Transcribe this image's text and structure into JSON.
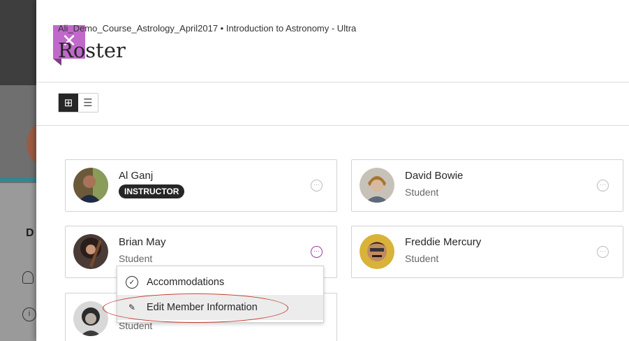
{
  "breadcrumb": "Ali_Demo_Course_Astrology_April2017 • Introduction to Astronomy - Ultra",
  "title": "Roster",
  "close_icon": "✕",
  "background": {
    "letter": "D",
    "info_glyph": "i"
  },
  "view_toggle": {
    "grid_icon": "⊞",
    "list_icon": "☰"
  },
  "more_glyph": "···",
  "members": [
    {
      "name": "Al Ganj",
      "role": "INSTRUCTOR",
      "is_instructor": true
    },
    {
      "name": "David Bowie",
      "role": "Student"
    },
    {
      "name": "Brian May",
      "role": "Student"
    },
    {
      "name": "Freddie Mercury",
      "role": "Student"
    },
    {
      "name": "",
      "role": "Student"
    }
  ],
  "context_menu": {
    "items": [
      {
        "label": "Accommodations",
        "icon": "check-circle-icon",
        "glyph": "✓"
      },
      {
        "label": "Edit Member Information",
        "icon": "pencil-icon",
        "glyph": "✎"
      }
    ]
  },
  "colors": {
    "close": "#c168cb",
    "active_more": "#9a3f9e",
    "annotation": "#c0392b"
  }
}
